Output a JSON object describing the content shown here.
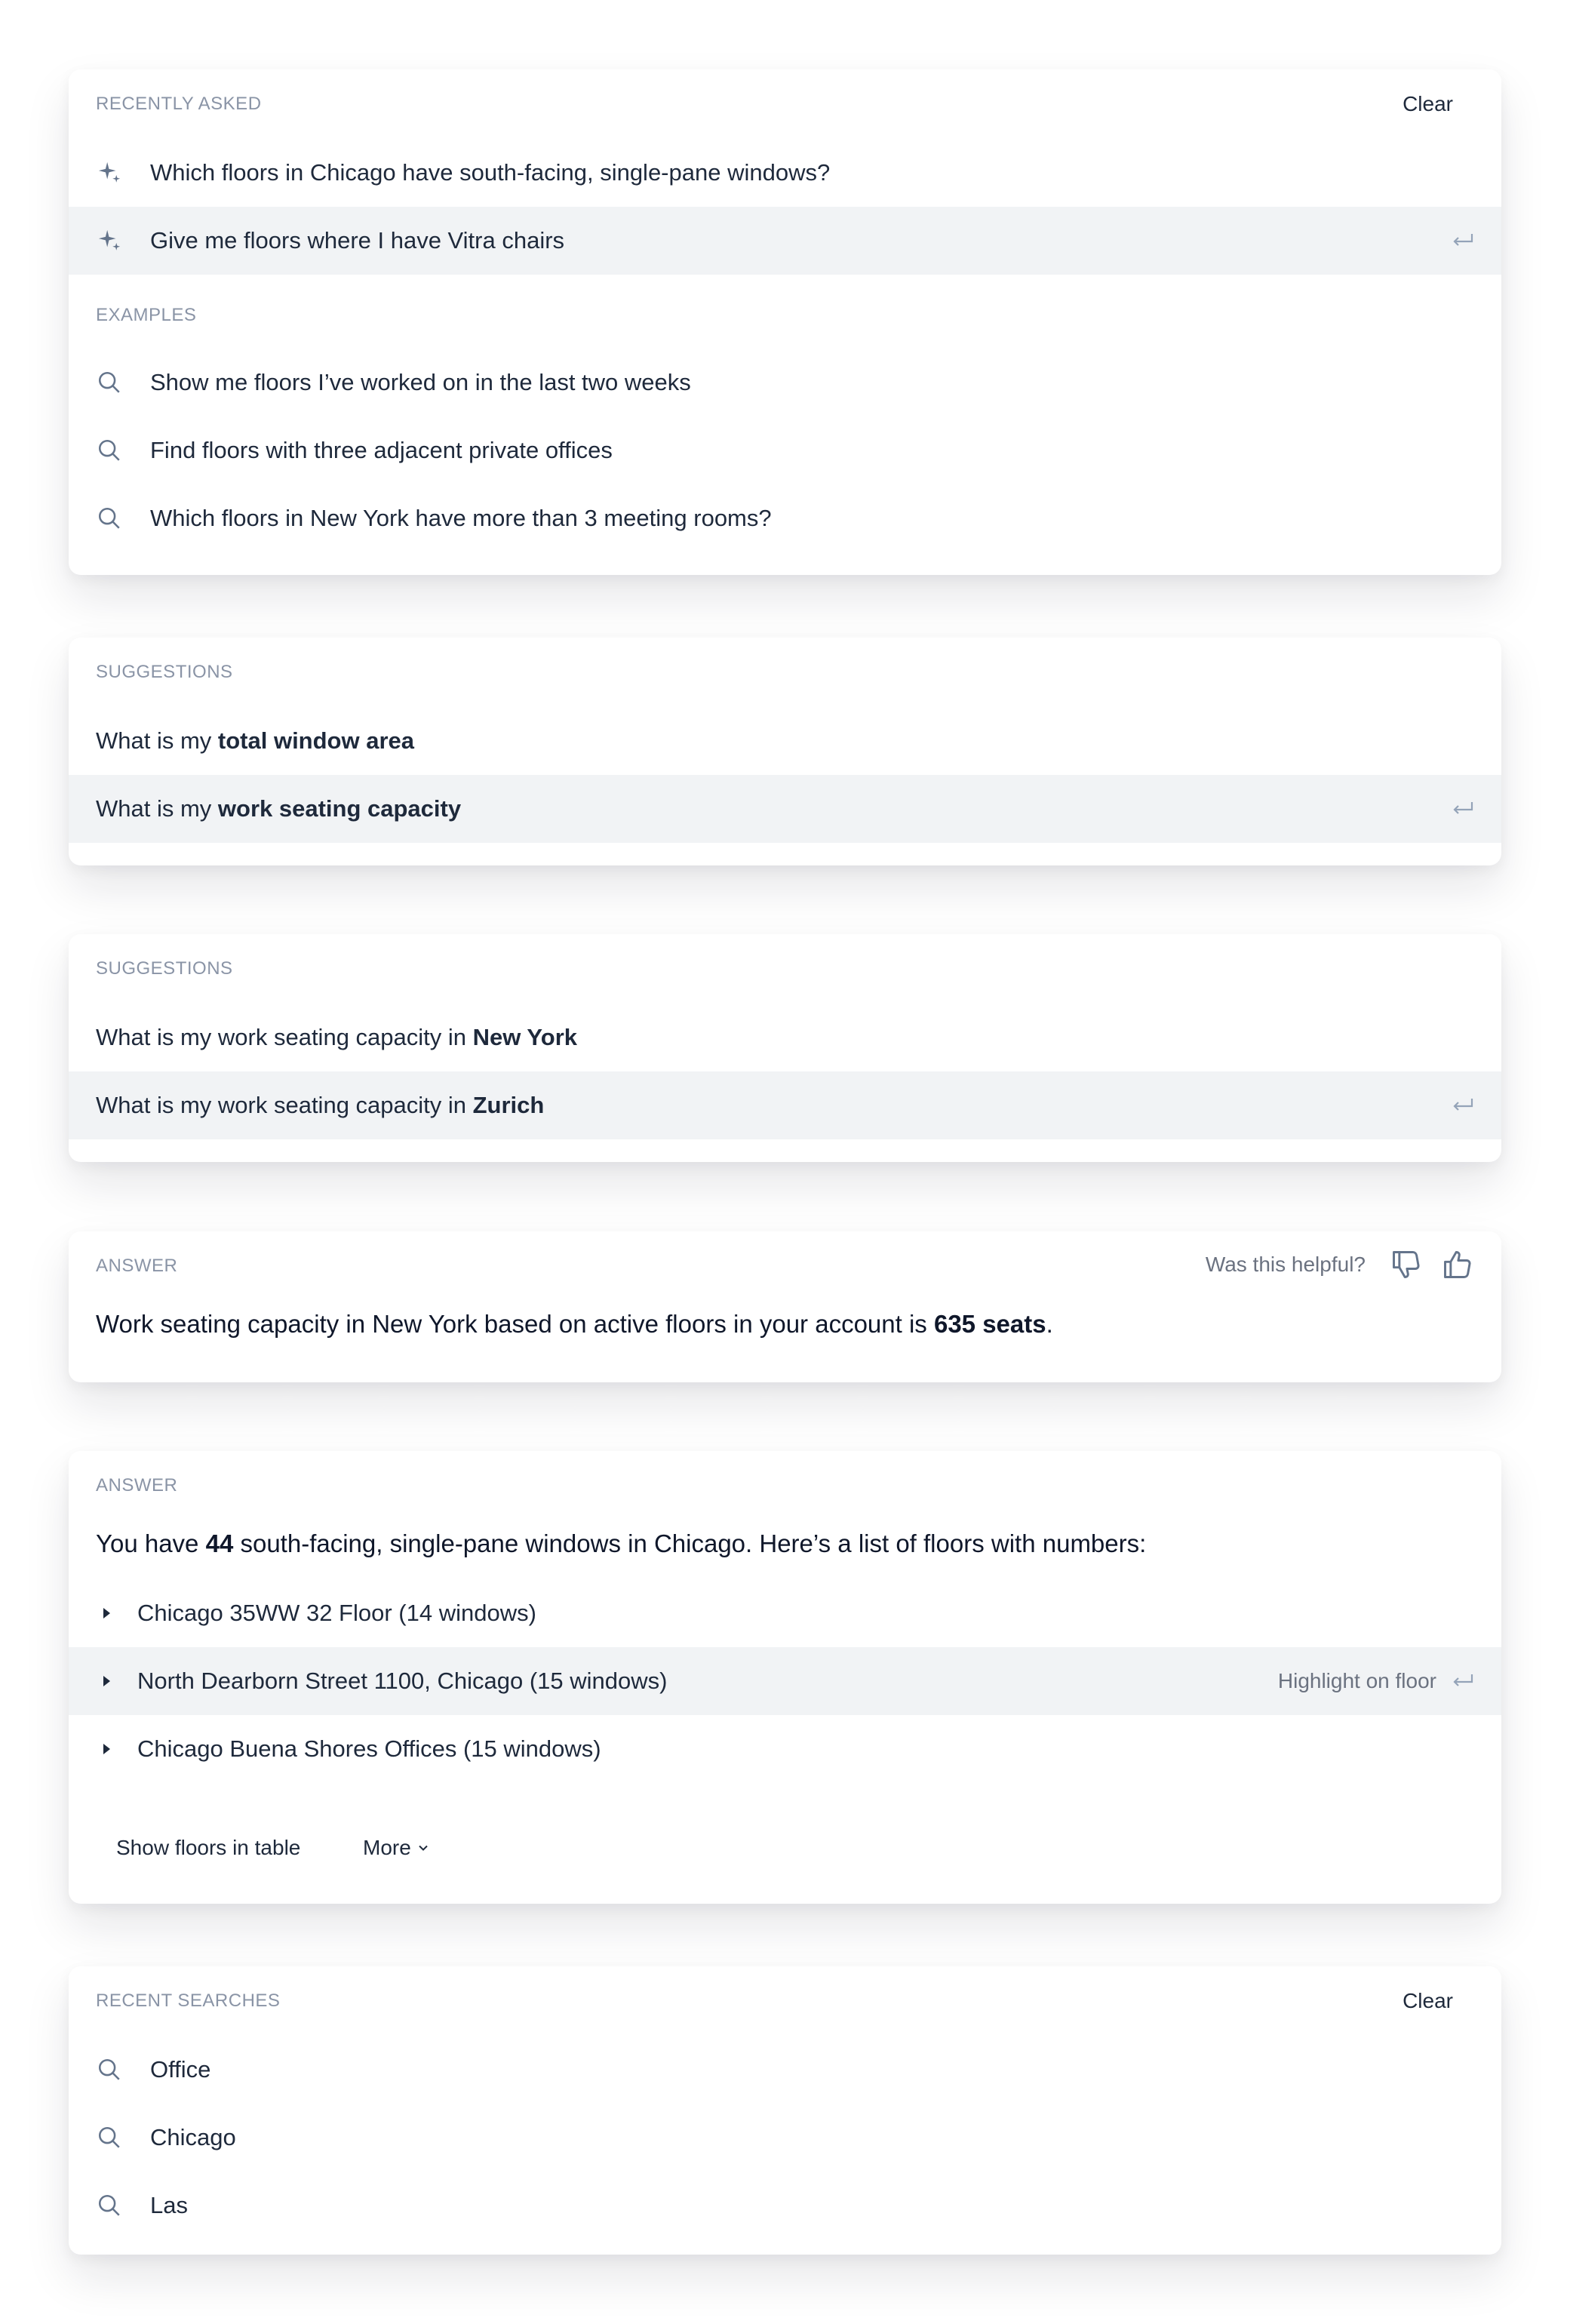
{
  "recently_asked": {
    "label": "RECENTLY ASKED",
    "clear": "Clear",
    "items": [
      {
        "text": "Which floors in Chicago have south-facing, single-pane windows?"
      },
      {
        "text": "Give me floors where I have Vitra chairs"
      }
    ]
  },
  "examples": {
    "label": "EXAMPLES",
    "items": [
      {
        "text": "Show me floors I’ve worked on in the last two weeks"
      },
      {
        "text": "Find floors with three adjacent private offices"
      },
      {
        "text": "Which floors in New York have more than 3 meeting rooms?"
      }
    ]
  },
  "suggestions_1": {
    "label": "SUGGESTIONS",
    "items": [
      {
        "prefix": "What is my ",
        "bold": "total window area"
      },
      {
        "prefix": "What is my ",
        "bold": "work seating capacity"
      }
    ]
  },
  "suggestions_2": {
    "label": "SUGGESTIONS",
    "items": [
      {
        "prefix": "What is my work seating capacity in ",
        "bold": "New York"
      },
      {
        "prefix": "What is my work seating capacity in ",
        "bold": "Zurich"
      }
    ]
  },
  "answer_1": {
    "label": "ANSWER",
    "helpful": "Was this helpful?",
    "prefix": "Work seating capacity in New York based on active floors in your account is ",
    "bold": "635 seats",
    "suffix": "."
  },
  "answer_2": {
    "label": "ANSWER",
    "prefix": "You have ",
    "bold": "44",
    "suffix": " south-facing, single-pane windows in Chicago. Here’s a list of floors with numbers:",
    "floors": [
      {
        "text": "Chicago 35WW 32 Floor (14 windows)"
      },
      {
        "text": "North Dearborn Street 1100, Chicago (15 windows)",
        "hint": "Highlight on floor"
      },
      {
        "text": "Chicago Buena Shores Offices (15 windows)"
      }
    ],
    "show_table": "Show floors in table",
    "more": "More"
  },
  "recent_searches": {
    "label": "RECENT SEARCHES",
    "clear": "Clear",
    "items": [
      {
        "text": "Office"
      },
      {
        "text": "Chicago"
      },
      {
        "text": "Las"
      }
    ]
  },
  "colors": {
    "text": "#1e293b",
    "muted": "#8a94a6",
    "highlight_row": "#f1f3f5",
    "icon": "#64748b"
  },
  "icons": {
    "ai": "sparkle-icon",
    "search": "search-icon",
    "enter": "enter-icon",
    "thumbs_down": "thumbs-down-icon",
    "thumbs_up": "thumbs-up-icon",
    "caret": "caret-right-icon",
    "chevron": "chevron-down-icon"
  }
}
